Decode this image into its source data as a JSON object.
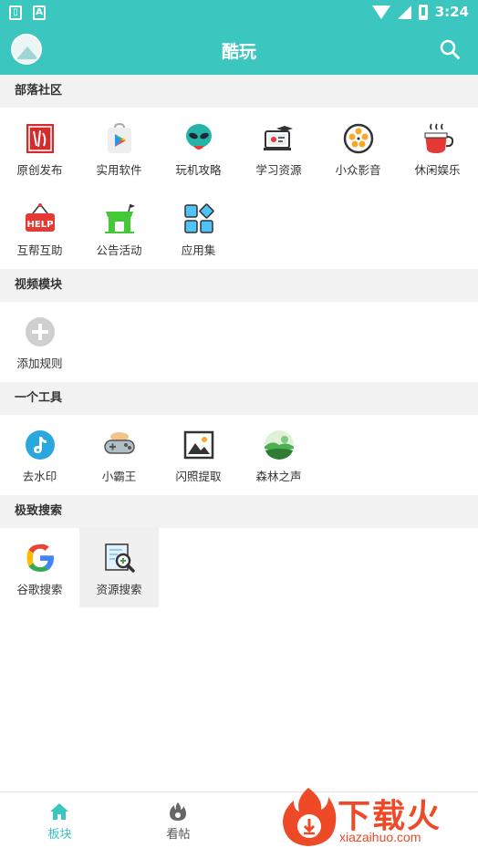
{
  "status_bar": {
    "time": "3:24",
    "icons": [
      "sim-icon",
      "a-notification-icon",
      "wifi-icon",
      "signal-icon",
      "battery-icon"
    ]
  },
  "app_bar": {
    "title": "酷玩",
    "colors": {
      "primary": "#3cc6c0"
    }
  },
  "sections": [
    {
      "title": "部落社区",
      "items": [
        "原创发布",
        "实用软件",
        "玩机攻略",
        "学习资源",
        "小众影音",
        "休闲娱乐",
        "互帮互助",
        "公告活动",
        "应用集"
      ]
    },
    {
      "title": "视频模块",
      "items": [
        "添加规则"
      ]
    },
    {
      "title": "一个工具",
      "items": [
        "去水印",
        "小霸王",
        "闪照提取",
        "森林之声"
      ]
    },
    {
      "title": "极致搜索",
      "items": [
        "谷歌搜索",
        "资源搜索"
      ]
    }
  ],
  "bottom_nav": [
    {
      "label": "板块",
      "active": true
    },
    {
      "label": "看帖",
      "active": false
    }
  ],
  "watermark": {
    "cn": "下载火",
    "en": "xiazaihuo.com"
  }
}
